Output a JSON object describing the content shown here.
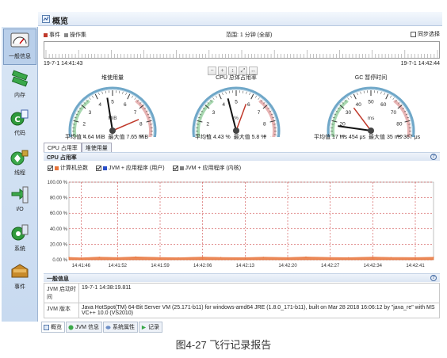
{
  "window": {
    "title": "概览"
  },
  "sidebar": {
    "items": [
      {
        "label": "一般信息",
        "icon": "gauge-icon"
      },
      {
        "label": "内存",
        "icon": "memory-icon"
      },
      {
        "label": "代码",
        "icon": "code-icon"
      },
      {
        "label": "线程",
        "icon": "threads-icon"
      },
      {
        "label": "I/O",
        "icon": "io-icon"
      },
      {
        "label": "系统",
        "icon": "system-icon"
      },
      {
        "label": "事件",
        "icon": "events-icon"
      }
    ]
  },
  "events_bar": {
    "legend_event": "事件",
    "legend_operation": "操作集",
    "range_text": "范围: 1 分钟 (全部)",
    "sync_label": "同步选择",
    "sync_checked": false
  },
  "timeline": {
    "start": "19-7-1 14:41:43",
    "end": "19-7-1 14:42:44"
  },
  "gauges": [
    {
      "title": "堆使用量",
      "unit": "MiB",
      "ticks": [
        "0",
        "1",
        "2",
        "3",
        "4",
        "5",
        "6",
        "7",
        "8",
        "9",
        "10"
      ],
      "max": 10,
      "value": 4.64,
      "peak": 7.65,
      "avg_label": "平均值",
      "avg_value": "4.64 MiB",
      "max_label": "最大值",
      "max_value": "7.65 MiB"
    },
    {
      "title": "CPU 总体占用率",
      "unit": "%",
      "ticks": [
        "0",
        "1",
        "2",
        "3",
        "4",
        "5",
        "6",
        "7",
        "8",
        "9",
        "10"
      ],
      "max": 10,
      "value": 4.43,
      "peak": 5.8,
      "avg_label": "平均值",
      "avg_value": "4.43 %",
      "max_label": "最大值",
      "max_value": "5.8 %"
    },
    {
      "title": "GC 暂停时间",
      "unit": "ms",
      "ticks": [
        "0",
        "10",
        "20",
        "30",
        "40",
        "50",
        "60",
        "70",
        "80",
        "90",
        "100"
      ],
      "max": 100,
      "value": 17.454,
      "peak": 35.367,
      "avg_label": "平均值",
      "avg_value": "17 ms 454 μs",
      "max_label": "最大值",
      "max_value": "35 ms 367 μs"
    }
  ],
  "cpu_tabs": [
    "CPU 占用率",
    "堆使用量"
  ],
  "cpu_panel": {
    "title": "CPU 占用率",
    "legend": [
      {
        "label": "计算机总数",
        "color": "#e8743b",
        "checked": true
      },
      {
        "label": "JVM + 应用程序 (用户)",
        "color": "#2a4fc9",
        "checked": true
      },
      {
        "label": "JVM + 应用程序 (内核)",
        "color": "#808080",
        "checked": true
      }
    ]
  },
  "chart_data": {
    "type": "area",
    "title": "CPU 占用率",
    "xlabel": "",
    "ylabel": "",
    "ylim": [
      0,
      100
    ],
    "yticks": [
      "0.00 %",
      "20.00 %",
      "40.00 %",
      "60.00 %",
      "80.00 %",
      "100.00 %"
    ],
    "xticks": [
      "14:41:46",
      "14:41:52",
      "14:41:59",
      "14:42:06",
      "14:42:13",
      "14:42:20",
      "14:42:27",
      "14:42:34",
      "14:42:41"
    ],
    "grid": true,
    "series": [
      {
        "name": "计算机总数",
        "color": "#e8743b",
        "x": [
          "14:41:44",
          "14:41:46",
          "14:41:49",
          "14:41:52",
          "14:41:55",
          "14:41:59",
          "14:42:02",
          "14:42:06",
          "14:42:09",
          "14:42:13",
          "14:42:16",
          "14:42:20",
          "14:42:23",
          "14:42:27",
          "14:42:30",
          "14:42:34",
          "14:42:37",
          "14:42:41",
          "14:42:44"
        ],
        "values": [
          3.2,
          2.6,
          3.5,
          2.9,
          3.8,
          3.0,
          2.7,
          3.6,
          3.1,
          2.8,
          3.4,
          2.9,
          3.7,
          3.0,
          2.8,
          3.5,
          3.1,
          2.9,
          3.3
        ]
      }
    ]
  },
  "general_info": {
    "title": "一般信息",
    "rows": [
      {
        "key": "JVM 启动时间",
        "value": "19-7-1 14:38:19.811"
      },
      {
        "key": "JVM 版本",
        "value": "Java HotSpot(TM) 64-Bit Server VM (25.171-b11) for windows-amd64 JRE (1.8.0_171-b11), built on Mar 28 2018 16:06:12 by \"java_re\" with MS VC++ 10.0 (VS2010)"
      }
    ]
  },
  "bottom_tabs": [
    {
      "label": "概览",
      "icon": "overview-icon"
    },
    {
      "label": "JVM 信息",
      "icon": "jvm-info-icon"
    },
    {
      "label": "系统属性",
      "icon": "properties-icon"
    },
    {
      "label": "记录",
      "icon": "record-icon"
    }
  ],
  "caption": "图4-27 飞行记录报告"
}
